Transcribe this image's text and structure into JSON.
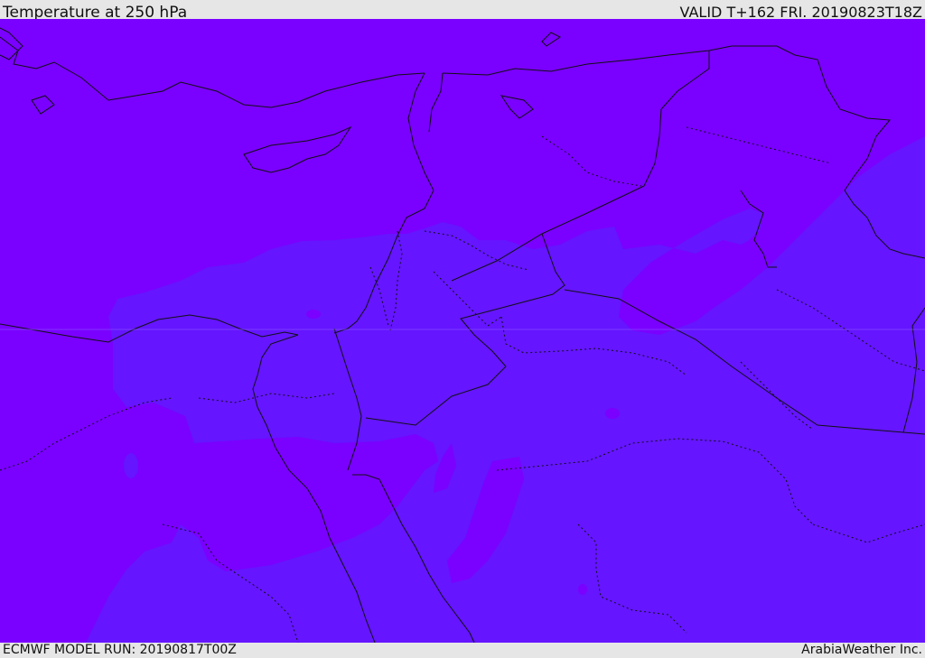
{
  "header": {
    "title": "Temperature at 250 hPa",
    "valid": "VALID T+162 FRI. 20190823T18Z"
  },
  "footer": {
    "model_run": "ECMWF MODEL RUN: 20190817T00Z",
    "credit": "ArabiaWeather Inc."
  },
  "colors": {
    "background": "#e6e6e6",
    "warmer_band": "#7a00ff",
    "cooler_band": "#6515ff",
    "border": "#111111"
  }
}
